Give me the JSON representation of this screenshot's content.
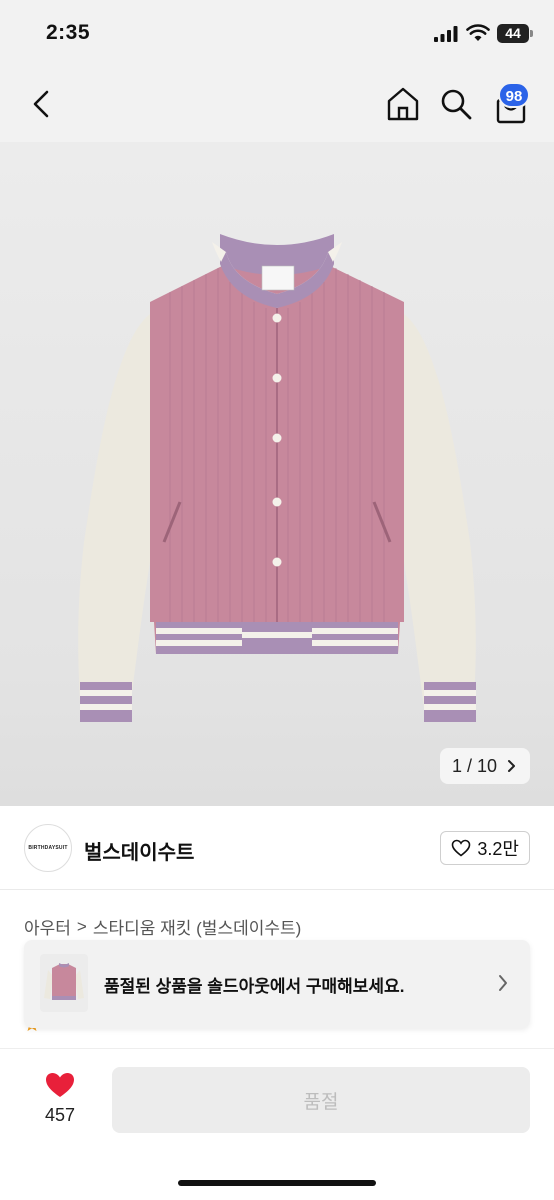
{
  "status": {
    "time": "2:35",
    "battery": "44"
  },
  "nav": {
    "cart_badge": "98",
    "icons": [
      "chevron-left-icon",
      "home-icon",
      "search-icon",
      "shopping-bag-icon"
    ]
  },
  "gallery": {
    "counter": "1 / 10",
    "product_colors": {
      "body": "#c7889c",
      "sleeve": "#ece9df",
      "rib_purple": "#a98fb5",
      "rib_cream": "#f4f1ea"
    }
  },
  "brand": {
    "logo_text": "BIRTHDAYSUIT",
    "name": "벌스데이수트",
    "likes": "3.2만"
  },
  "breadcrumb": {
    "category": "아우터",
    "separator": ">",
    "product": "스타디움 재킷 (벌스데이수트)"
  },
  "banner": {
    "text": "품절된 상품을 솔드아웃에서 구매해보세요."
  },
  "bottom": {
    "wish_count": "457",
    "buy_label": "품절"
  },
  "colors": {
    "accent": "#2b63e8",
    "heart": "#e8203a",
    "disabled": "#ececec"
  }
}
